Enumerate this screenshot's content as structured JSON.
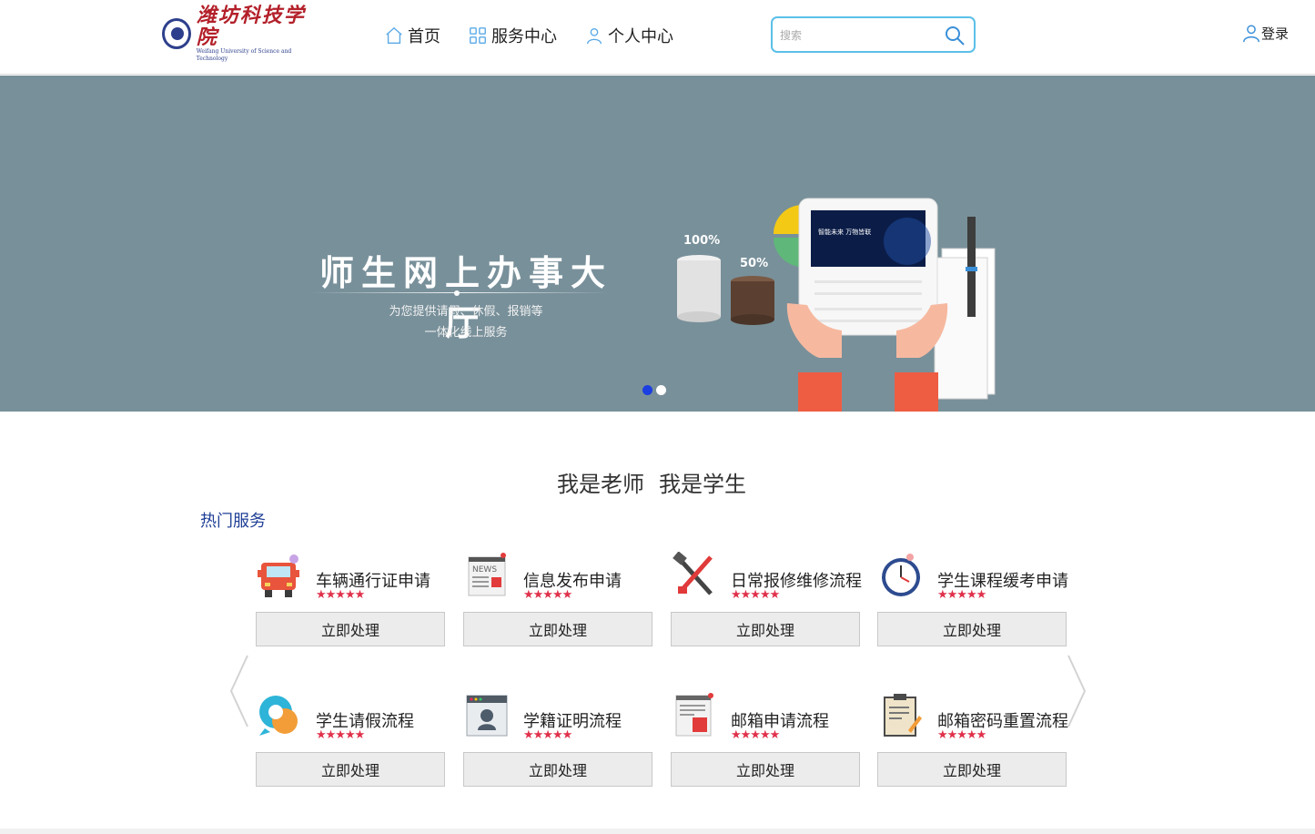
{
  "header": {
    "logo_text": "潍坊科技学院",
    "logo_subtext": "Weifang University of Science and Technology",
    "nav": [
      {
        "label": "首页",
        "icon": "home-icon"
      },
      {
        "label": "服务中心",
        "icon": "grid-icon"
      },
      {
        "label": "个人中心",
        "icon": "user-icon"
      }
    ],
    "search_placeholder": "搜索",
    "login_label": "登录"
  },
  "banner": {
    "title": "师生网上办事大厅",
    "subtitle_line1": "为您提供请假、休假、报销等",
    "subtitle_line2": "一体化线上服务",
    "chart_label_100": "100%",
    "chart_label_50": "50%",
    "tablet_caption": "智能未来 万物皆联",
    "active_slide": 1,
    "slide_count": 2
  },
  "roles": {
    "teacher": "我是老师",
    "student": "我是学生"
  },
  "hot_services_title": "热门服务",
  "services": [
    {
      "name": "车辆通行证申请",
      "rating": 5,
      "action": "立即处理",
      "icon": "truck-icon"
    },
    {
      "name": "信息发布申请",
      "rating": 5,
      "action": "立即处理",
      "icon": "news-icon"
    },
    {
      "name": "日常报修维修流程",
      "rating": 5,
      "action": "立即处理",
      "icon": "repair-tools-icon"
    },
    {
      "name": "学生课程缓考申请",
      "rating": 5,
      "action": "立即处理",
      "icon": "clock-icon"
    },
    {
      "name": "学生请假流程",
      "rating": 5,
      "action": "立即处理",
      "icon": "chat-bubble-icon"
    },
    {
      "name": "学籍证明流程",
      "rating": 5,
      "action": "立即处理",
      "icon": "id-card-icon"
    },
    {
      "name": "邮箱申请流程",
      "rating": 5,
      "action": "立即处理",
      "icon": "document-icon"
    },
    {
      "name": "邮箱密码重置流程",
      "rating": 5,
      "action": "立即处理",
      "icon": "clipboard-icon"
    }
  ],
  "stars_text": "★★★★★",
  "colors": {
    "banner_bg": "#78909a",
    "accent_blue": "#1f3f97",
    "search_border": "#5bc0e8",
    "star_red": "#e0314b",
    "active_dot": "#1b3fe0"
  }
}
